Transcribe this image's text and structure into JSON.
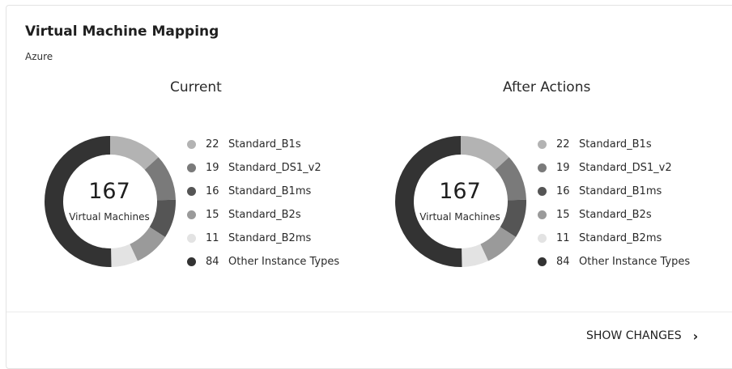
{
  "widget": {
    "title": "Virtual Machine Mapping",
    "subtitle": "Azure",
    "footer_button": "SHOW CHANGES",
    "footer_chevron": "chevron-right-icon"
  },
  "panels": [
    {
      "title": "Current",
      "total": "167",
      "total_label": "Virtual Machines",
      "segments": [
        {
          "count": 22,
          "name": "Standard_B1s",
          "color": "#b3b3b3"
        },
        {
          "count": 19,
          "name": "Standard_DS1_v2",
          "color": "#7a7a7a"
        },
        {
          "count": 16,
          "name": "Standard_B1ms",
          "color": "#555555"
        },
        {
          "count": 15,
          "name": "Standard_B2s",
          "color": "#9a9a9a"
        },
        {
          "count": 11,
          "name": "Standard_B2ms",
          "color": "#e3e3e3"
        },
        {
          "count": 84,
          "name": "Other Instance Types",
          "color": "#333333"
        }
      ]
    },
    {
      "title": "After Actions",
      "total": "167",
      "total_label": "Virtual Machines",
      "segments": [
        {
          "count": 22,
          "name": "Standard_B1s",
          "color": "#b3b3b3"
        },
        {
          "count": 19,
          "name": "Standard_DS1_v2",
          "color": "#7a7a7a"
        },
        {
          "count": 16,
          "name": "Standard_B1ms",
          "color": "#555555"
        },
        {
          "count": 15,
          "name": "Standard_B2s",
          "color": "#9a9a9a"
        },
        {
          "count": 11,
          "name": "Standard_B2ms",
          "color": "#e3e3e3"
        },
        {
          "count": 84,
          "name": "Other Instance Types",
          "color": "#333333"
        }
      ]
    }
  ]
}
